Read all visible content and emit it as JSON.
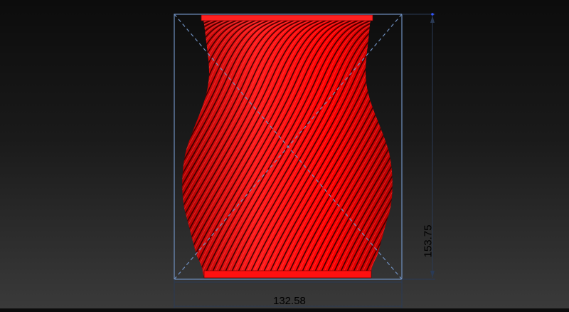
{
  "viewport": {
    "model_color": "#ff0000",
    "bounding_box_color": "#6f8fbf",
    "dimension_line_color": "#2a3a55"
  },
  "dimensions": {
    "width_value": "132.58",
    "height_value": "153.75"
  }
}
